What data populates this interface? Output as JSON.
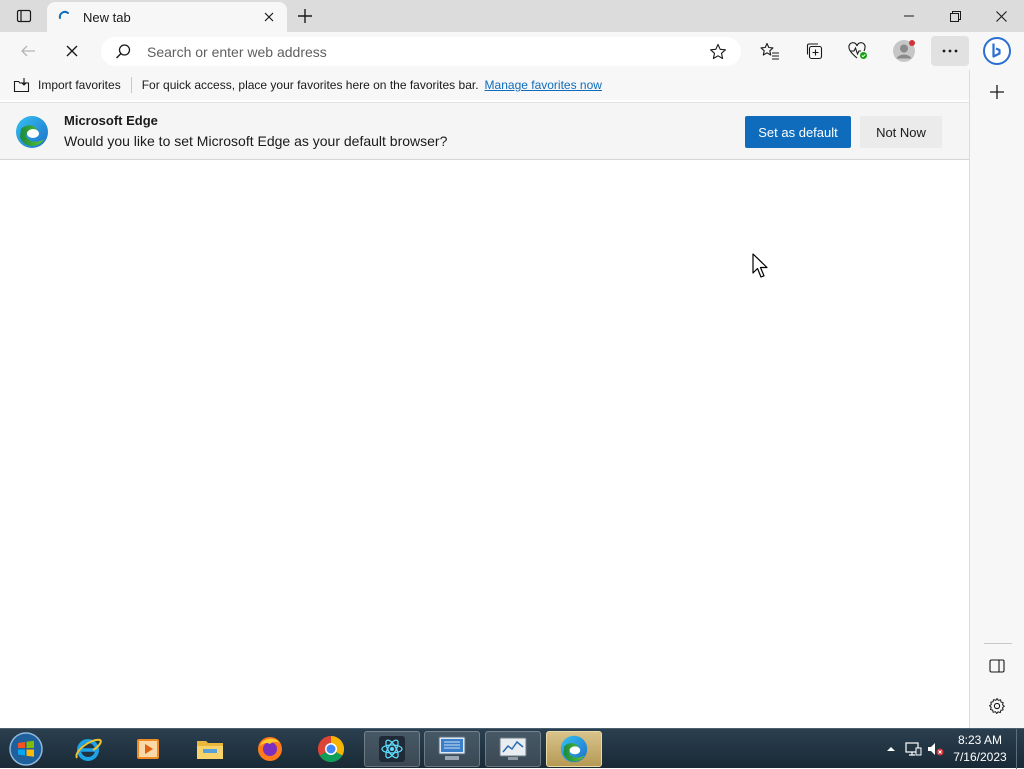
{
  "browser": {
    "tab": {
      "title": "New tab"
    },
    "address": {
      "placeholder": "Search or enter web address"
    }
  },
  "favorites_bar": {
    "import_label": "Import favorites",
    "hint": "For quick access, place your favorites here on the favorites bar.",
    "manage_link": "Manage favorites now"
  },
  "banner": {
    "title": "Microsoft Edge",
    "message": "Would you like to set Microsoft Edge as your default browser?",
    "primary_label": "Set as default",
    "secondary_label": "Not Now"
  },
  "taskbar": {
    "apps": [
      "internet-explorer",
      "media-player",
      "file-explorer",
      "firefox",
      "chrome",
      "react-devtools",
      "remote-desktop",
      "task-monitor",
      "edge"
    ],
    "clock": {
      "time": "8:23 AM",
      "date": "7/16/2023"
    }
  },
  "colors": {
    "accent": "#0f6cbd",
    "titlebar": "#dcdcdc",
    "toolbar": "#f7f7f7",
    "taskbar": "#1f3140"
  }
}
